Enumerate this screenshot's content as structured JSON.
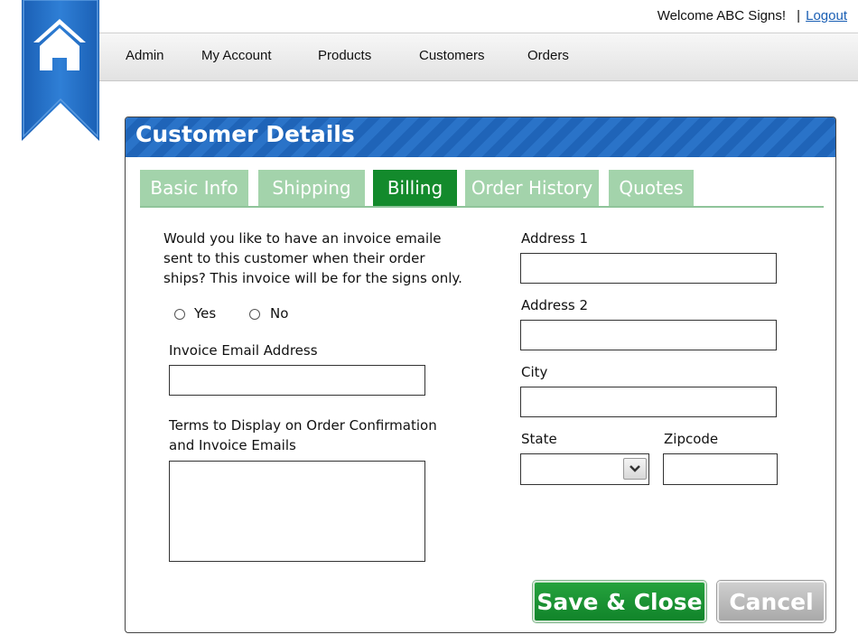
{
  "header": {
    "welcome_text": "Welcome ABC Signs!",
    "separator": "|",
    "logout_label": "Logout"
  },
  "nav": {
    "items": [
      {
        "label": "Admin"
      },
      {
        "label": "My Account"
      },
      {
        "label": "Products"
      },
      {
        "label": "Customers"
      },
      {
        "label": "Orders"
      }
    ]
  },
  "panel": {
    "title": "Customer Details",
    "tabs": [
      {
        "label": "Basic Info",
        "active": false
      },
      {
        "label": "Shipping",
        "active": false
      },
      {
        "label": "Billing",
        "active": true
      },
      {
        "label": "Order History",
        "active": false
      },
      {
        "label": "Quotes",
        "active": false
      }
    ]
  },
  "form": {
    "invoice_question": "Would you like to have an invoice emaile sent to this customer when their order ships?  This invoice will be for the signs only.",
    "radio_yes_label": "Yes",
    "radio_no_label": "No",
    "invoice_email_label": "Invoice Email Address",
    "invoice_email_value": "",
    "terms_label": "Terms to Display on Order Confirmation and Invoice Emails",
    "terms_value": "",
    "address1_label": "Address 1",
    "address1_value": "",
    "address2_label": "Address 2",
    "address2_value": "",
    "city_label": "City",
    "city_value": "",
    "state_label": "State",
    "state_value": "",
    "zipcode_label": "Zipcode",
    "zipcode_value": ""
  },
  "actions": {
    "save_label": "Save & Close",
    "cancel_label": "Cancel"
  },
  "colors": {
    "brand_blue": "#1f64b8",
    "tab_active": "#138a2c",
    "tab_inactive": "#a3d3ab",
    "save_green": "#11842a",
    "cancel_gray": "#a9a9a9",
    "link_blue": "#1a5fb4"
  }
}
